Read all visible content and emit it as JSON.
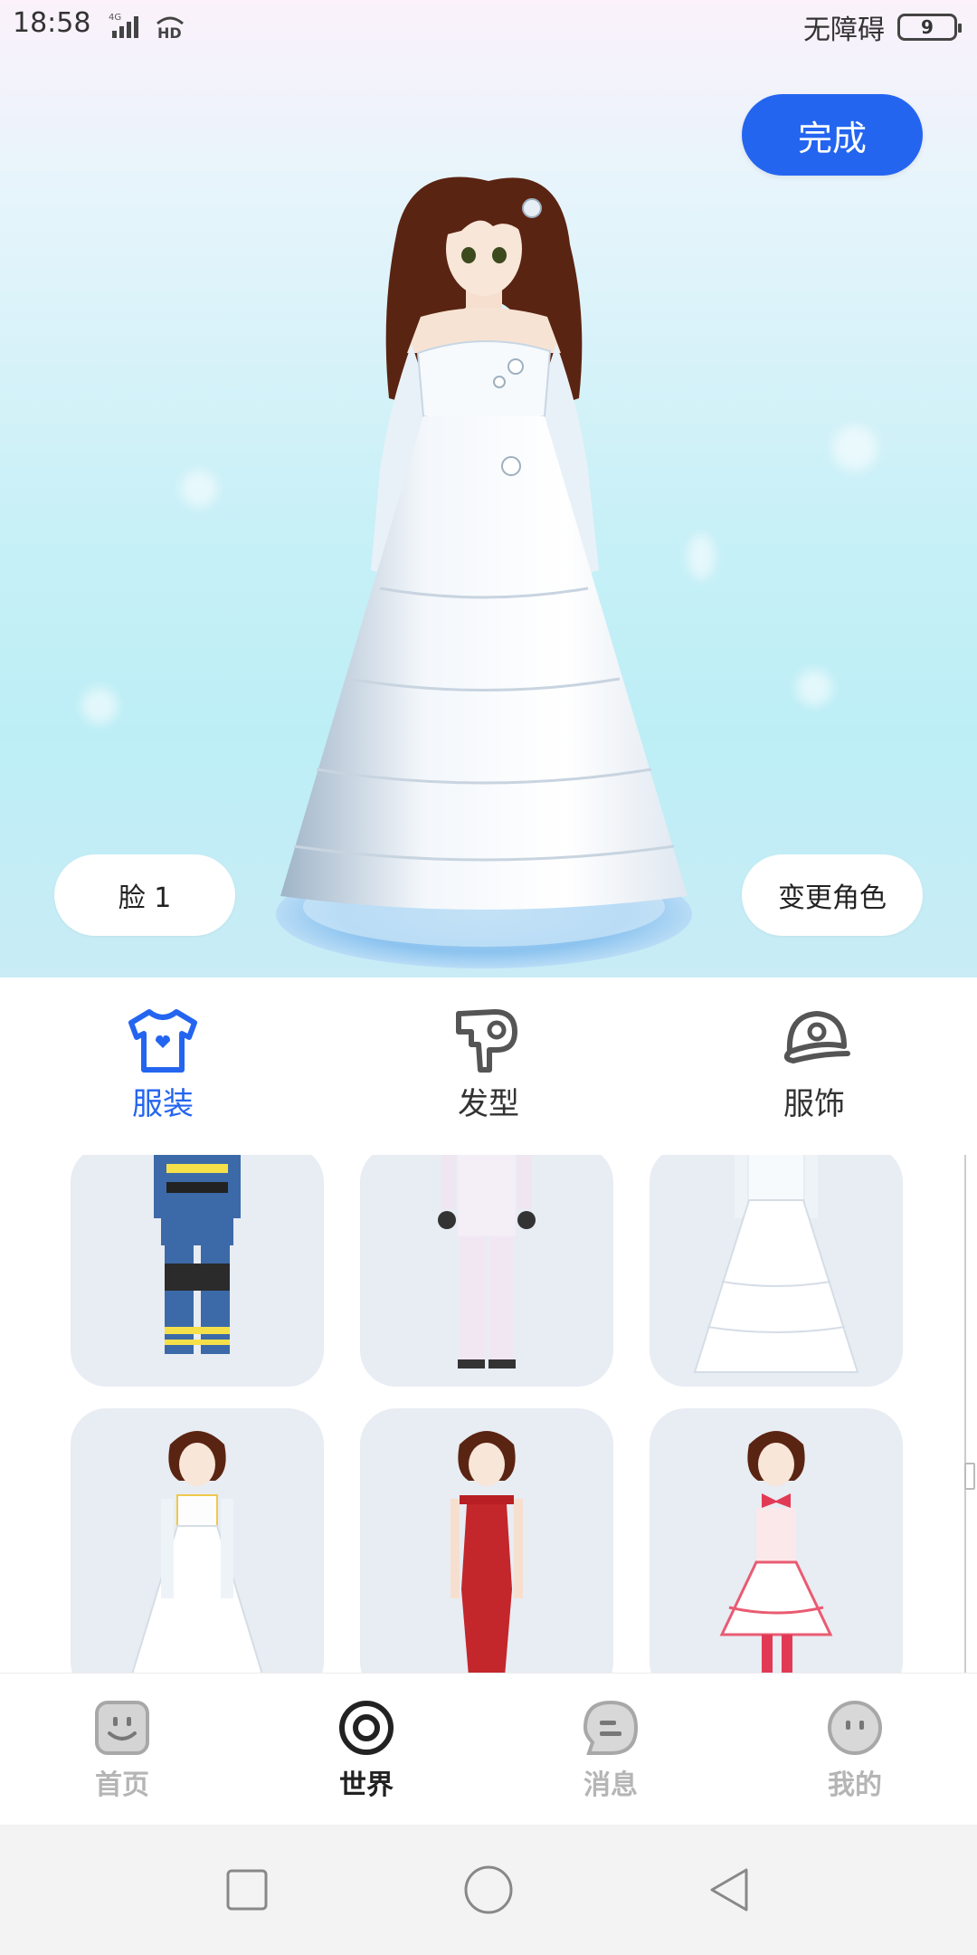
{
  "status_bar": {
    "time": "18:58",
    "network": "4G",
    "hd": "HD",
    "accessibility": "无障碍",
    "battery": "9"
  },
  "stage": {
    "done_label": "完成",
    "face_label": "脸 1",
    "change_role_label": "变更角色"
  },
  "tabs": [
    {
      "label": "服装",
      "icon": "shirt-icon",
      "active": true
    },
    {
      "label": "发型",
      "icon": "hair-dryer-icon",
      "active": false
    },
    {
      "label": "服饰",
      "icon": "cap-icon",
      "active": false
    }
  ],
  "outfits": [
    {
      "name": "firefighter-outfit"
    },
    {
      "name": "white-jumpsuit-outfit"
    },
    {
      "name": "white-wedding-dress-outfit"
    },
    {
      "name": "white-strapless-gown-outfit"
    },
    {
      "name": "red-evening-dress-outfit"
    },
    {
      "name": "pink-maid-dress-outfit"
    }
  ],
  "bottom_nav": [
    {
      "label": "首页",
      "icon": "home-face-icon",
      "active": false
    },
    {
      "label": "世界",
      "icon": "world-ring-icon",
      "active": true
    },
    {
      "label": "消息",
      "icon": "message-bubble-icon",
      "active": false
    },
    {
      "label": "我的",
      "icon": "profile-face-icon",
      "active": false
    }
  ],
  "colors": {
    "accent": "#2465f0",
    "card_bg": "#e8ecf3",
    "inactive": "#b5b5b5"
  }
}
